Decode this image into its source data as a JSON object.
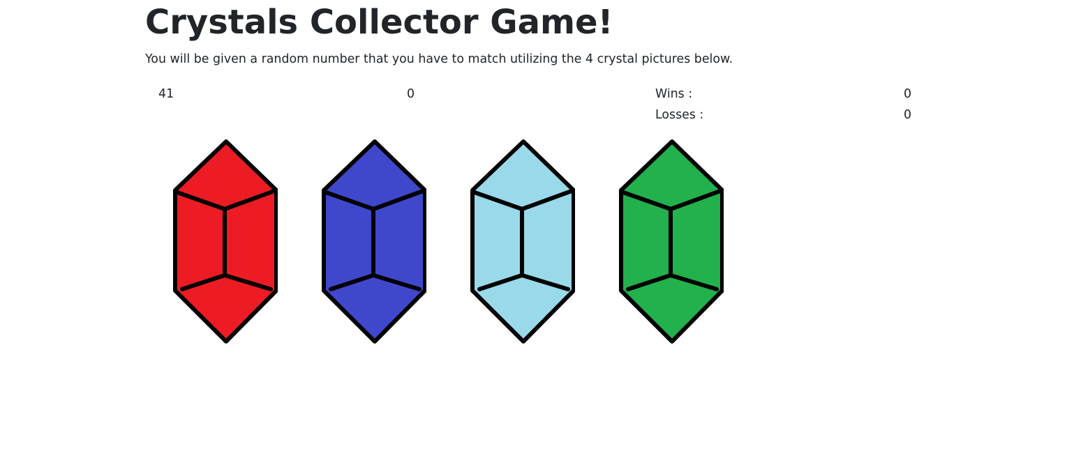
{
  "header": {
    "title": "Crystals Collector Game!",
    "instructions": "You will be given a random number that you have to match utilizing the 4 crystal pictures below."
  },
  "game": {
    "target_number": "41",
    "current_score": "0",
    "wins_label": "Wins :",
    "wins_value": "0",
    "losses_label": "Losses :",
    "losses_value": "0"
  },
  "crystals": [
    {
      "name": "red crystal",
      "color": "#ED1C24"
    },
    {
      "name": "blue crystal",
      "color": "#3F48CC"
    },
    {
      "name": "light blue crystal",
      "color": "#99D9EA"
    },
    {
      "name": "green crystal",
      "color": "#22B14C"
    }
  ]
}
